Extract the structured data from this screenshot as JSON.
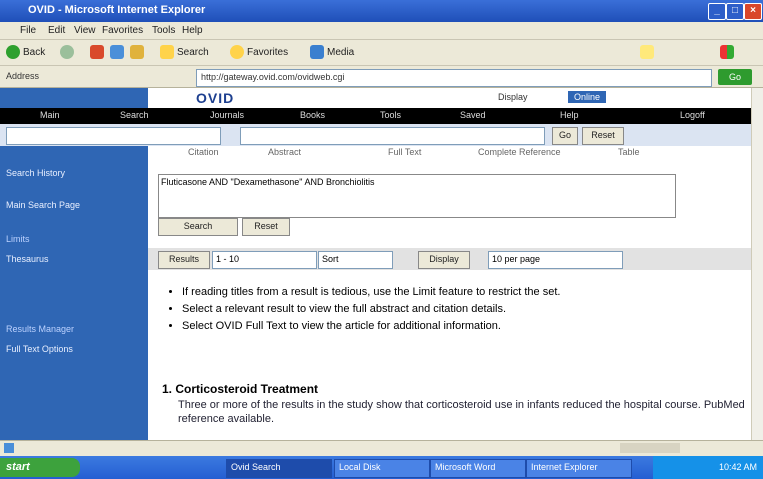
{
  "window": {
    "title": "OVID - Microsoft Internet Explorer"
  },
  "menu": [
    "File",
    "Edit",
    "View",
    "Favorites",
    "Tools",
    "Help"
  ],
  "toolbar": {
    "back": "Back",
    "search": "Search",
    "favorites": "Favorites",
    "media": "Media"
  },
  "address": {
    "label": "Address",
    "url": "http://gateway.ovid.com/ovidweb.cgi",
    "go": "Go"
  },
  "header": {
    "logo": "OVID",
    "mode_label": "Display",
    "mode_value": "Online"
  },
  "nav": [
    "Main",
    "Search",
    "Journals",
    "Books",
    "Tools",
    "Saved",
    "Help",
    "Logoff"
  ],
  "search": {
    "field_value": "",
    "go_label": "Go",
    "reset_label": "Reset"
  },
  "subtabs": [
    "Citation",
    "Abstract",
    "Full Text",
    "Complete Reference",
    "Table"
  ],
  "sidebar": {
    "items": [
      "Search History",
      "Main Search Page",
      "Limits",
      "Thesaurus",
      "Results Manager",
      "Full Text Options"
    ]
  },
  "query": {
    "text": "Fluticasone AND \"Dexamethasone\" AND Bronchiolitis",
    "primary_btn": "Search",
    "secondary_btn": "Reset"
  },
  "filter": {
    "label": "Results",
    "sort": "Sort",
    "results": "1 - 10",
    "perpage_label": "Display",
    "perpage_value": "10 per page"
  },
  "bullets": [
    "If reading titles from a result is tedious, use the Limit feature to restrict the set.",
    "Select a relevant result to view the full abstract and citation details.",
    "Select OVID Full Text to view the article for additional information."
  ],
  "result": {
    "title": "1. Corticosteroid Treatment",
    "body": "Three or more of the results in the study show that corticosteroid use in infants reduced the hospital course. PubMed reference available."
  },
  "taskbar": {
    "start": "start",
    "tasks": [
      "Ovid Search",
      "Local Disk",
      "Microsoft Word",
      "Internet Explorer"
    ],
    "clock": "10:42 AM"
  }
}
